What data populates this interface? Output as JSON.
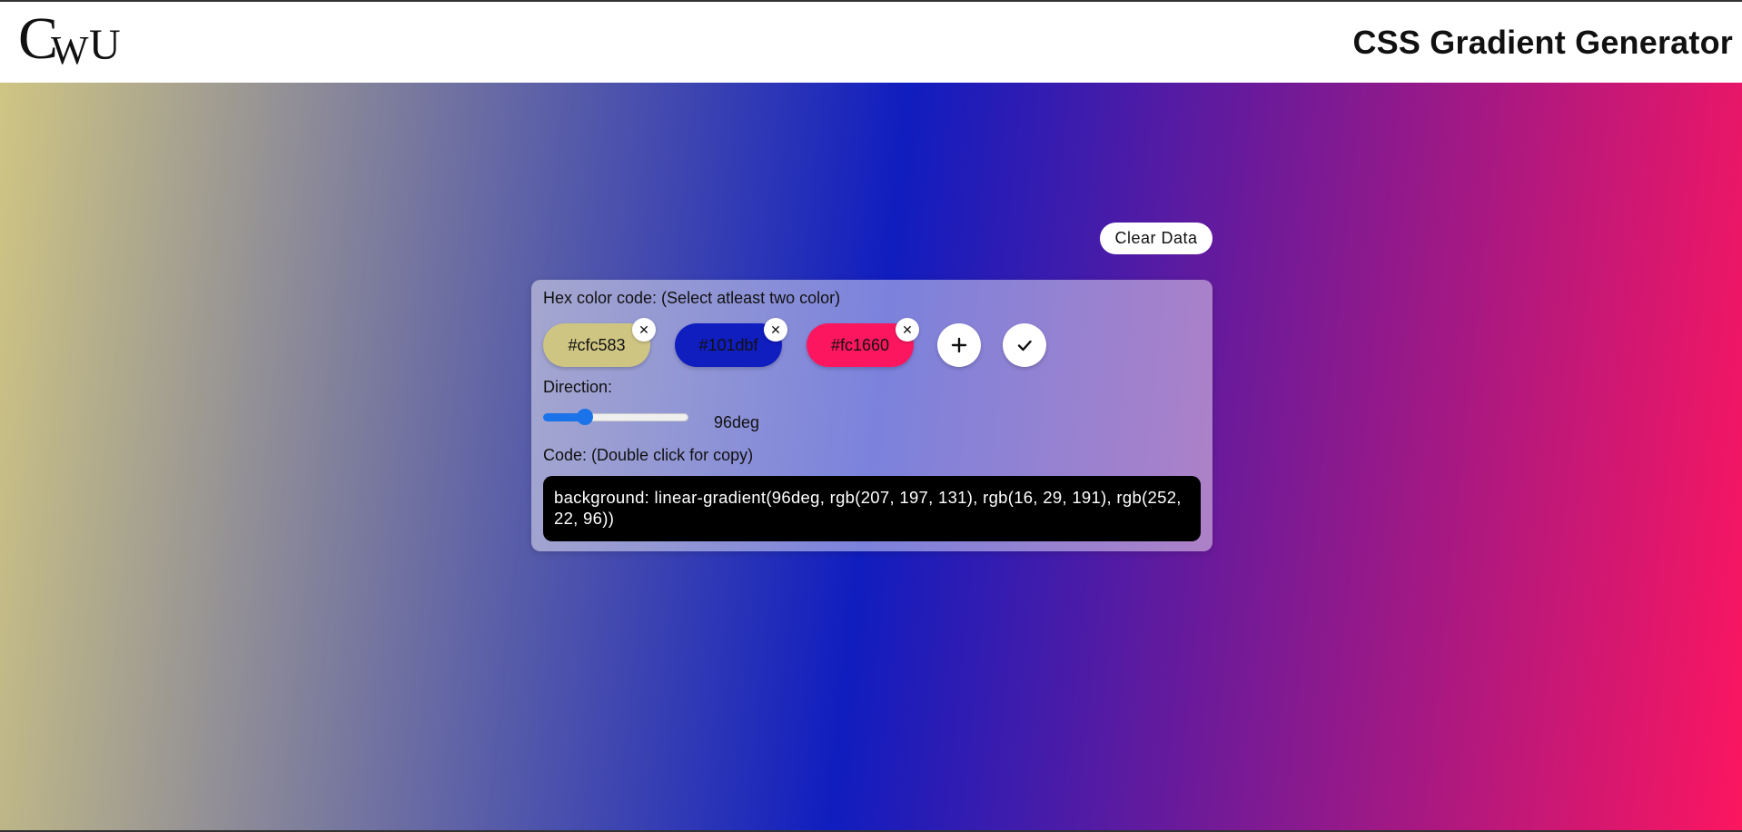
{
  "header": {
    "logo": {
      "c": "C",
      "w": "W",
      "u": "U"
    },
    "title": "CSS Gradient Generator"
  },
  "controls": {
    "clear_label": "Clear Data",
    "hex_label": "Hex color code: (Select atleast two color)",
    "colors": [
      {
        "hex": "#cfc583",
        "remove": "✕"
      },
      {
        "hex": "#101dbf",
        "remove": "✕"
      },
      {
        "hex": "#fc1660",
        "remove": "✕"
      }
    ],
    "add_icon": "plus-icon",
    "apply_icon": "check-icon",
    "direction_label": "Direction:",
    "direction_value": 96,
    "direction_text": "96deg",
    "code_label": "Code: (Double click for copy)",
    "code": "background: linear-gradient(96deg, rgb(207, 197, 131), rgb(16, 29, 191), rgb(252, 22, 96))"
  },
  "gradient": {
    "stops": [
      "#cfc583",
      "#101dbf",
      "#fc1660"
    ]
  }
}
